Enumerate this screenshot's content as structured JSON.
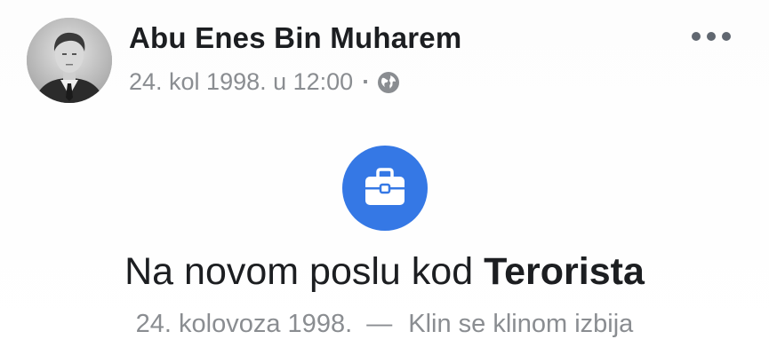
{
  "post": {
    "author": "Abu Enes Bin Muharem",
    "timestamp": "24. kol 1998. u 12:00",
    "separator": "·",
    "privacy_icon": "globe-icon",
    "more_icon": "more-options-icon"
  },
  "life_event": {
    "icon": "briefcase-icon",
    "icon_color": "#3578e5",
    "title_prefix": "Na novom poslu kod ",
    "title_employer": "Terorista",
    "date": "24. kolovoza 1998.",
    "dash": "—",
    "description": "Klin se klinom izbija"
  },
  "colors": {
    "text_primary": "#1c1e21",
    "text_secondary": "#8a8d91",
    "accent": "#3578e5"
  }
}
